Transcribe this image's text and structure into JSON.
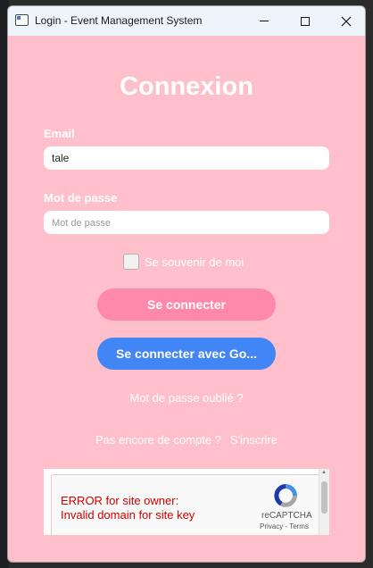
{
  "window": {
    "title": "Login - Event Management System"
  },
  "form": {
    "heading": "Connexion",
    "email_label": "Email",
    "email_value": "tale",
    "password_label": "Mot de passe",
    "password_placeholder": "Mot de passe",
    "remember_label": "Se souvenir de moi",
    "remember_checked": false,
    "login_button": "Se connecter",
    "google_button": "Se connecter avec Go...",
    "forgot_link": "Mot de passe oublié ?",
    "no_account_text": "Pas encore de compte ?",
    "signup_link": "S'inscrire"
  },
  "recaptcha": {
    "error_line1": "ERROR for site owner:",
    "error_line2": "Invalid domain for site key",
    "brand": "reCAPTCHA",
    "terms": "Privacy - Terms"
  },
  "colors": {
    "background": "#ffc0cb",
    "login_button": "#ff89aa",
    "google_button": "#4285f4",
    "error_text": "#d00000"
  },
  "icons": {
    "app": "app-window-icon",
    "minimize": "minimize-icon",
    "maximize": "maximize-icon",
    "close": "close-icon",
    "recaptcha": "recaptcha-logo-icon"
  }
}
